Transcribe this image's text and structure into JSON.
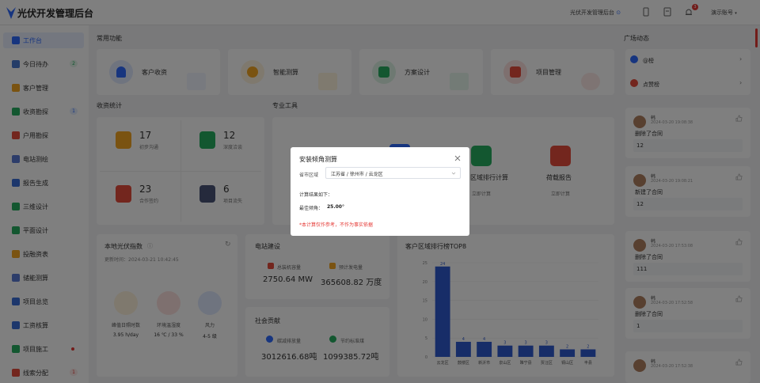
{
  "header": {
    "app_title": "光伏开发管理后台",
    "link_label": "光伏开发管理后台",
    "notification_count": "3",
    "user_label": "演示账号"
  },
  "sidebar": {
    "items": [
      {
        "label": "工作台",
        "icon": "home-icon",
        "active": true
      },
      {
        "label": "今日待办",
        "icon": "todo-icon",
        "badge": "2"
      },
      {
        "label": "客户管理",
        "icon": "customer-icon"
      },
      {
        "label": "收资勘探",
        "icon": "survey-icon",
        "badge": "1"
      },
      {
        "label": "户用勘探",
        "icon": "household-icon"
      },
      {
        "label": "电站测绘",
        "icon": "mapping-icon"
      },
      {
        "label": "报告生成",
        "icon": "report-icon"
      },
      {
        "label": "三维设计",
        "icon": "3d-icon"
      },
      {
        "label": "平面设计",
        "icon": "plan-icon"
      },
      {
        "label": "投融资表",
        "icon": "finance-icon"
      },
      {
        "label": "储能测算",
        "icon": "storage-icon"
      },
      {
        "label": "项目总览",
        "icon": "overview-icon"
      },
      {
        "label": "工资核算",
        "icon": "salary-icon"
      },
      {
        "label": "项目施工",
        "icon": "construction-icon",
        "dot": true
      },
      {
        "label": "线索分配",
        "icon": "lead-icon",
        "badge": "1"
      }
    ]
  },
  "common": {
    "title": "常用功能",
    "items": [
      {
        "label": "客户收资",
        "color": "#2f6bff"
      },
      {
        "label": "智能测算",
        "color": "#f5a623"
      },
      {
        "label": "方案设计",
        "color": "#27ae60"
      },
      {
        "label": "项目管理",
        "color": "#e74c3c"
      }
    ]
  },
  "stats": {
    "title": "收资统计",
    "items": [
      {
        "value": "17",
        "label": "初步沟通",
        "color": "#f5a623"
      },
      {
        "value": "12",
        "label": "深度洽谈",
        "color": "#27ae60"
      },
      {
        "value": "23",
        "label": "合作签约",
        "color": "#e74c3c"
      },
      {
        "value": "6",
        "label": "项目流失",
        "color": "#4a5578"
      }
    ]
  },
  "tools": {
    "title": "专业工具",
    "items": [
      {
        "label": "区域排行计算",
        "sub": "立即计算",
        "color": "#27ae60"
      },
      {
        "label": "荷载报告",
        "sub": "立即计算",
        "color": "#e74c3c"
      }
    ]
  },
  "weather": {
    "title": "本地光伏指数",
    "updated": "更新时间：2024-03-21 10:42:45",
    "items": [
      {
        "label": "峰值日照时数",
        "value": "3.95 h/day",
        "color": "#f5a623"
      },
      {
        "label": "环境温湿度",
        "value": "16 ℃ / 33 %",
        "color": "#e74c3c"
      },
      {
        "label": "风力",
        "value": "4-5 级",
        "color": "#2f6bff"
      }
    ]
  },
  "station": {
    "title": "电站建设",
    "items": [
      {
        "label": "总装机容量",
        "value": "2750.64 MW"
      },
      {
        "label": "预计发电量",
        "value": "365608.82 万度"
      }
    ]
  },
  "social": {
    "title": "社会贡献",
    "items": [
      {
        "label": "碳减排放量",
        "value": "3012616.68吨"
      },
      {
        "label": "节约标准煤",
        "value": "1099385.72吨"
      }
    ]
  },
  "chart_data": {
    "type": "bar",
    "title": "客户区域排行榜TOP8",
    "categories": [
      "云龙区",
      "鼓楼区",
      "新沂市",
      "泉山区",
      "睢宁县",
      "贾汪区",
      "铜山区",
      "丰县"
    ],
    "values": [
      24,
      4,
      4,
      3,
      3,
      3,
      2,
      2
    ],
    "ylim": [
      0,
      25
    ],
    "yticks": [
      "0",
      "5",
      "10",
      "15",
      "20",
      "25"
    ],
    "color": "#2f5bd1"
  },
  "square": {
    "title": "广场动态",
    "links": [
      {
        "label": "@榜"
      },
      {
        "label": "点赞榜"
      }
    ],
    "feed": [
      {
        "name": "韩",
        "time": "2024-03-20 19:08:38",
        "action": "删除了合同",
        "content": "12"
      },
      {
        "name": "韩",
        "time": "2024-03-20 19:08:21",
        "action": "新建了合同",
        "content": "12"
      },
      {
        "name": "韩",
        "time": "2024-03-20 17:53:08",
        "action": "删除了合同",
        "content": "111"
      },
      {
        "name": "韩",
        "time": "2024-03-20 17:52:58",
        "action": "删除了合同",
        "content": "1"
      },
      {
        "name": "韩",
        "time": "2024-03-20 17:52:38",
        "action": "",
        "content": ""
      }
    ]
  },
  "modal": {
    "title": "安装倾角测算",
    "region_label": "省市区域",
    "region_value": "江苏省 / 徐州市 / 云龙区",
    "result_label": "计算结果如下：",
    "angle_label": "最佳倾角：",
    "angle_value": "25.00°",
    "note": "*本计算仅作参考，不作为事实依据"
  }
}
